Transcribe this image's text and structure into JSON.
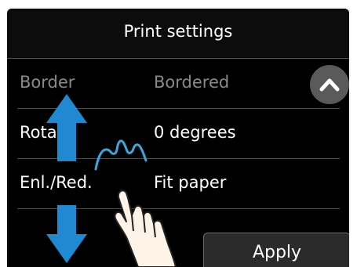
{
  "header": {
    "title": "Print settings"
  },
  "settings": [
    {
      "label": "Border",
      "value": "Bordered"
    },
    {
      "label": "Rotate",
      "value": "0 degrees"
    },
    {
      "label": "Enl./Red.",
      "value": "Fit paper"
    }
  ],
  "actions": {
    "apply_label": "Apply"
  },
  "colors": {
    "arrow": "#1f8ad1",
    "highlight": "#3aa8e0",
    "background": "#000000",
    "text": "#ffffff"
  }
}
